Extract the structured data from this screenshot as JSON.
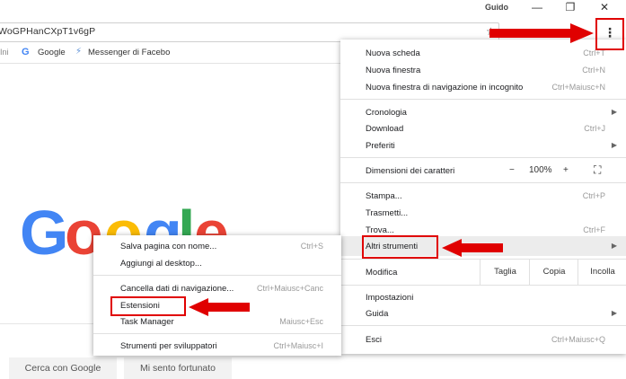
{
  "window": {
    "profile_name": "Guido",
    "minimize": "—",
    "restore": "❐",
    "close": "✕"
  },
  "toolbar": {
    "url": "WoGPHanCXpT1v6gP",
    "star_icon": "☆",
    "menu_icon": "⋮"
  },
  "bookmarks": {
    "apps_fragment": "Ini",
    "items": [
      {
        "label": "Google",
        "icon": "google-g-icon"
      },
      {
        "label": "Messenger di Facebo",
        "icon": "messenger-icon"
      }
    ]
  },
  "google_page": {
    "logo_letters": [
      "G",
      "o",
      "o",
      "g",
      "l",
      "e"
    ],
    "logo_colors": [
      "#4285f4",
      "#ea4335",
      "#fbbc05",
      "#4285f4",
      "#34a853",
      "#ea4335"
    ],
    "search_button": "Cerca con Google",
    "lucky_button": "Mi sento fortunato"
  },
  "main_menu": {
    "items": [
      {
        "label": "Nuova scheda",
        "shortcut": "Ctrl+T"
      },
      {
        "label": "Nuova finestra",
        "shortcut": "Ctrl+N"
      },
      {
        "label": "Nuova finestra di navigazione in incognito",
        "shortcut": "Ctrl+Maiusc+N"
      },
      {
        "label": "Cronologia",
        "shortcut": ""
      },
      {
        "label": "Download",
        "shortcut": "Ctrl+J"
      },
      {
        "label": "Preferiti",
        "shortcut": ""
      },
      {
        "label": "Dimensioni dei caratteri",
        "shortcut": ""
      },
      {
        "label": "Stampa...",
        "shortcut": "Ctrl+P"
      },
      {
        "label": "Trasmetti...",
        "shortcut": ""
      },
      {
        "label": "Trova...",
        "shortcut": "Ctrl+F"
      },
      {
        "label": "Altri strumenti",
        "shortcut": ""
      },
      {
        "label": "Modifica",
        "shortcut": ""
      },
      {
        "label": "Impostazioni",
        "shortcut": ""
      },
      {
        "label": "Guida",
        "shortcut": ""
      },
      {
        "label": "Esci",
        "shortcut": "Ctrl+Maiusc+Q"
      }
    ],
    "zoom": {
      "minus": "−",
      "value": "100%",
      "plus": "+",
      "fullscreen_icon": "⛶"
    },
    "edit": {
      "cut": "Taglia",
      "copy": "Copia",
      "paste": "Incolla"
    }
  },
  "submenu": {
    "items": [
      {
        "label": "Salva pagina con nome...",
        "shortcut": "Ctrl+S"
      },
      {
        "label": "Aggiungi al desktop...",
        "shortcut": ""
      },
      {
        "label": "Cancella dati di navigazione...",
        "shortcut": "Ctrl+Maiusc+Canc"
      },
      {
        "label": "Estensioni",
        "shortcut": ""
      },
      {
        "label": "Task Manager",
        "shortcut": "Maiusc+Esc"
      },
      {
        "label": "Strumenti per sviluppatori",
        "shortcut": "Ctrl+Maiusc+I"
      }
    ]
  },
  "annotation_color": "#e00000"
}
